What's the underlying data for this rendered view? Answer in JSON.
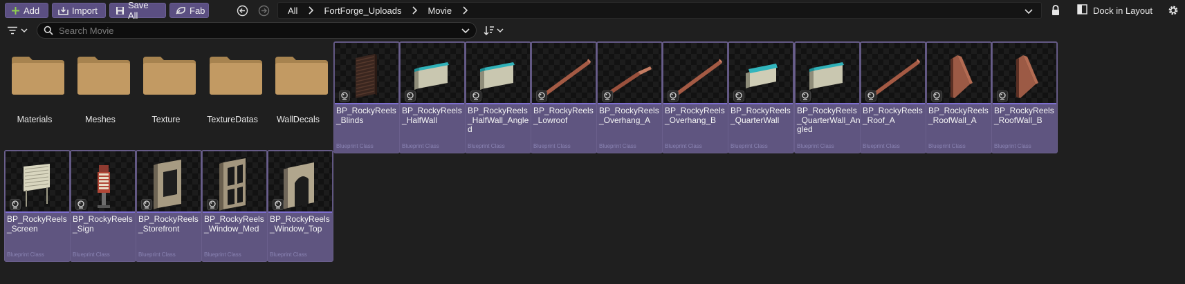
{
  "toolbar": {
    "add_label": "Add",
    "import_label": "Import",
    "save_all_label": "Save All",
    "fab_label": "Fab",
    "dock_label": "Dock in Layout"
  },
  "breadcrumb": [
    "All",
    "FortForge_Uploads",
    "Movie"
  ],
  "search": {
    "placeholder": "Search Movie",
    "value": ""
  },
  "folders": [
    {
      "label": "Materials"
    },
    {
      "label": "Meshes"
    },
    {
      "label": "Texture"
    },
    {
      "label": "TextureDatas"
    },
    {
      "label": "WallDecals"
    }
  ],
  "assets": [
    {
      "name": "BP_RockyReels_Blinds",
      "type": "Blueprint Class",
      "mesh": "blinds"
    },
    {
      "name": "BP_RockyReels_HalfWall",
      "type": "Blueprint Class",
      "mesh": "halfwall"
    },
    {
      "name": "BP_RockyReels_HalfWall_Angled",
      "type": "Blueprint Class",
      "mesh": "halfwall"
    },
    {
      "name": "BP_RockyReels_Lowroof",
      "type": "Blueprint Class",
      "mesh": "roofbeam"
    },
    {
      "name": "BP_RockyReels_Overhang_A",
      "type": "Blueprint Class",
      "mesh": "overhang"
    },
    {
      "name": "BP_RockyReels_Overhang_B",
      "type": "Blueprint Class",
      "mesh": "roofbeam"
    },
    {
      "name": "BP_RockyReels_QuarterWall",
      "type": "Blueprint Class",
      "mesh": "quarterwall"
    },
    {
      "name": "BP_RockyReels_QuarterWall_Angled",
      "type": "Blueprint Class",
      "mesh": "halfwall"
    },
    {
      "name": "BP_RockyReels_Roof_A",
      "type": "Blueprint Class",
      "mesh": "roofbeam"
    },
    {
      "name": "BP_RockyReels_RoofWall_A",
      "type": "Blueprint Class",
      "mesh": "roofwall"
    },
    {
      "name": "BP_RockyReels_RoofWall_B",
      "type": "Blueprint Class",
      "mesh": "roofwall"
    },
    {
      "name": "BP_RockyReels_Screen",
      "type": "Blueprint Class",
      "mesh": "screen"
    },
    {
      "name": "BP_RockyReels_Sign",
      "type": "Blueprint Class",
      "mesh": "sign"
    },
    {
      "name": "BP_RockyReels_Storefront",
      "type": "Blueprint Class",
      "mesh": "storefront"
    },
    {
      "name": "BP_RockyReels_Window_Med",
      "type": "Blueprint Class",
      "mesh": "window"
    },
    {
      "name": "BP_RockyReels_Window_Top",
      "type": "Blueprint Class",
      "mesh": "arch"
    }
  ],
  "colors": {
    "accent": "#5b4f82",
    "tile_bg": "#5f5580",
    "thumb_underline": "#7e6fd0",
    "folder": "#c29a63",
    "background": "#1f1f1f"
  },
  "icons": [
    "add-icon",
    "import-icon",
    "save-icon",
    "fab-icon",
    "back-icon",
    "forward-icon",
    "chevron-right-icon",
    "chevron-down-icon",
    "lock-icon",
    "dock-icon",
    "gear-icon",
    "filter-icon",
    "search-icon",
    "sort-icon",
    "folder-icon",
    "blueprint-icon"
  ]
}
